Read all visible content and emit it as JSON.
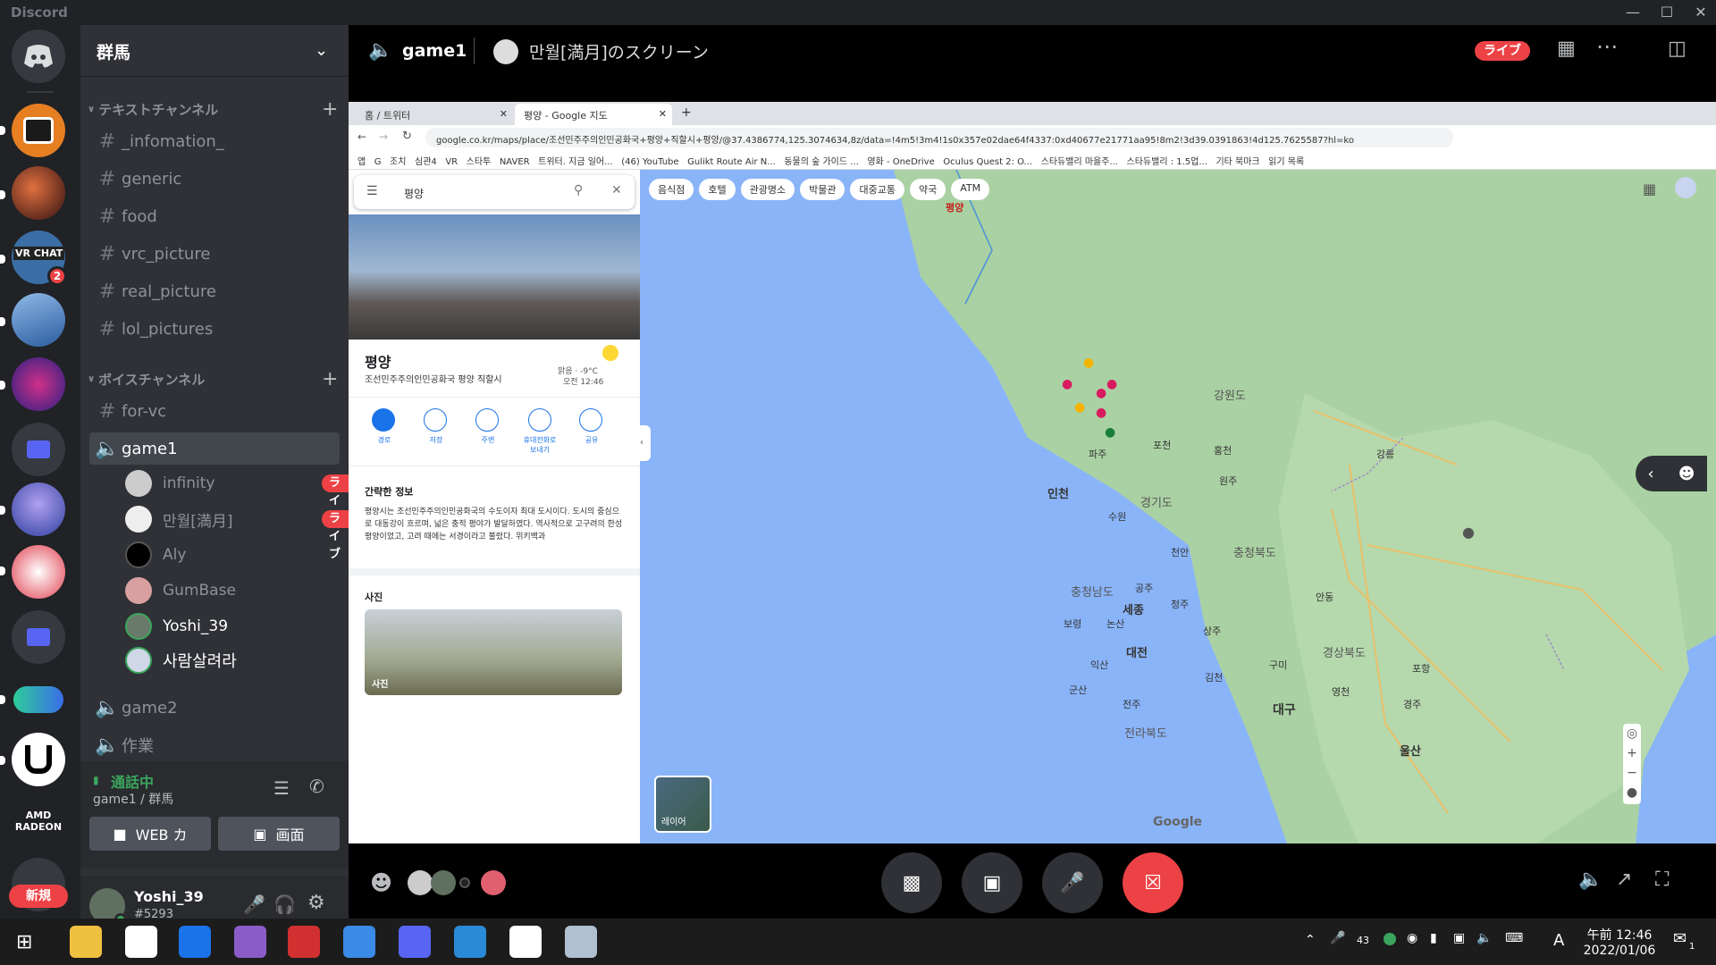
{
  "window": {
    "title": "Discord"
  },
  "server": {
    "name": "群馬"
  },
  "categories": {
    "text": "テキストチャンネル",
    "voice": "ボイスチャンネル"
  },
  "text_channels": [
    "_infomation_",
    "generic",
    "food",
    "vrc_picture",
    "real_picture",
    "lol_pictures"
  ],
  "voice_section": {
    "for_vc": "for-vc",
    "game1": "game1",
    "game2": "game2",
    "sagyou": "作業",
    "users": [
      {
        "name": "infinity",
        "live": "ライブ"
      },
      {
        "name": "만월[満月]",
        "live": "ライブ"
      },
      {
        "name": "Aly",
        "live": ""
      },
      {
        "name": "GumBase",
        "live": ""
      },
      {
        "name": "Yoshi_39",
        "live": ""
      },
      {
        "name": "사람살려라",
        "live": ""
      }
    ]
  },
  "voice_panel": {
    "status": "通話中",
    "location": "game1 / 群馬",
    "video_label": "WEB カ",
    "screen_label": "画面"
  },
  "user": {
    "name": "Yoshi_39",
    "tag": "#5293"
  },
  "guild_badges": {
    "vrchat_count": "2",
    "new_label": "新規"
  },
  "header": {
    "channel": "game1",
    "stream_title": "만월[満月]のスクリーン",
    "live_badge": "ライブ"
  },
  "browser": {
    "tabs": [
      "홈 / 트위터",
      "평양 - Google 지도"
    ],
    "url": "google.co.kr/maps/place/조선민주주의인민공화국+평양+직할시+평양/@37.4386774,125.3074634,8z/data=!4m5!3m4!1s0x357e02dae64f4337:0xd40677e21771aa95!8m2!3d39.0391863!4d125.7625587?hl=ko",
    "bookmarks": [
      "앱",
      "G",
      "조치",
      "심관4",
      "VR",
      "스타투",
      "NAVER",
      "트위터. 지금 일어...",
      "(46) YouTube",
      "Gulikt Route Air N...",
      "동물의 숲 가이드 ...",
      "영화 - OneDrive",
      "Oculus Quest 2: O...",
      "스타듀밸리 마을주...",
      "스타듀밸리 : 1.5업...",
      "기타 북마크",
      "읽기 목록"
    ]
  },
  "map": {
    "search_value": "평양",
    "filters": [
      "음식점",
      "호텔",
      "관광명소",
      "박물관",
      "대중교통",
      "약국",
      "ATM"
    ],
    "place_title": "평양",
    "place_subtitle": "조선민주주의인민공화국 평양 직할시",
    "weather": "맑음 · -9°C",
    "weather_time": "오전 12:46",
    "actions": [
      "경로",
      "저장",
      "주변",
      "휴대전화로 보내기",
      "공유"
    ],
    "info_heading": "간략한 정보",
    "info_text": "평양시는 조선민주주의인민공화국의 수도이자 최대 도시이다. 도시의 중심으로 대동강이 흐르며, 넓은 충적 평야가 발달하였다. 역사적으로 고구려의 한성평양이었고, 고려 때에는 서경이라고 불렸다. 위키백과",
    "photos_heading": "사진",
    "photo_label": "사진",
    "layer_label": "레이어",
    "labels": [
      "평양",
      "파주",
      "인천",
      "수원",
      "강원도",
      "경기도",
      "충청북도",
      "충청남도",
      "세종",
      "대전",
      "청주",
      "경상북도",
      "전라북도",
      "전주",
      "대구",
      "울산",
      "김천",
      "상주",
      "군산",
      "홍천",
      "원주",
      "강릉",
      "포천",
      "구미",
      "영천",
      "포항",
      "안동",
      "천안",
      "보령",
      "공주",
      "논산",
      "익산",
      "경주"
    ],
    "logo": "Google"
  },
  "taskbar": {
    "time": "午前 12:46",
    "date": "2022/01/06",
    "tray_num": "43",
    "lang": "A",
    "notif": "1"
  }
}
